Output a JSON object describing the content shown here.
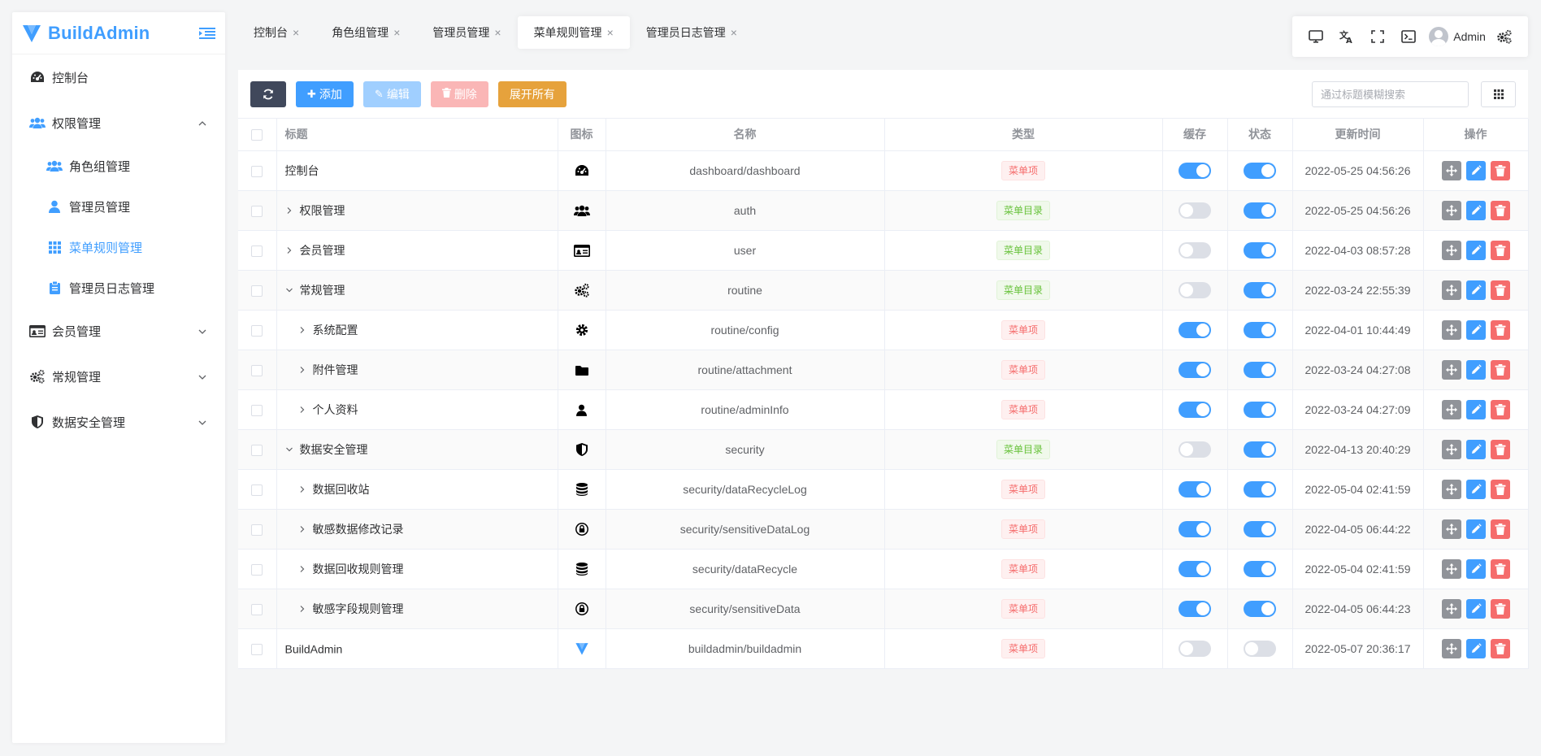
{
  "app": {
    "title": "BuildAdmin"
  },
  "sidebar": {
    "items": [
      {
        "label": "控制台"
      },
      {
        "label": "权限管理"
      },
      {
        "label": "角色组管理"
      },
      {
        "label": "管理员管理"
      },
      {
        "label": "菜单规则管理"
      },
      {
        "label": "管理员日志管理"
      },
      {
        "label": "会员管理"
      },
      {
        "label": "常规管理"
      },
      {
        "label": "数据安全管理"
      }
    ]
  },
  "tabs": [
    {
      "label": "控制台"
    },
    {
      "label": "角色组管理"
    },
    {
      "label": "管理员管理"
    },
    {
      "label": "菜单规则管理"
    },
    {
      "label": "管理员日志管理"
    }
  ],
  "navbar": {
    "user": "Admin"
  },
  "toolbar": {
    "add": "添加",
    "edit": "编辑",
    "delete": "删除",
    "expand_all": "展开所有",
    "search_placeholder": "通过标题模糊搜索"
  },
  "table": {
    "headers": {
      "title": "标题",
      "icon": "图标",
      "name": "名称",
      "type": "类型",
      "cache": "缓存",
      "status": "状态",
      "update_time": "更新时间",
      "operate": "操作"
    },
    "rows": [
      {
        "title": "控制台",
        "icon": "gauge-icon",
        "name": "dashboard/dashboard",
        "type": "菜单项",
        "cache": true,
        "status": true,
        "update_time": "2022-05-25 04:56:26"
      },
      {
        "title": "权限管理",
        "icon": "users-icon",
        "name": "auth",
        "type": "菜单目录",
        "cache": false,
        "status": true,
        "update_time": "2022-05-25 04:56:26"
      },
      {
        "title": "会员管理",
        "icon": "id-card-icon",
        "name": "user",
        "type": "菜单目录",
        "cache": false,
        "status": true,
        "update_time": "2022-04-03 08:57:28"
      },
      {
        "title": "常规管理",
        "icon": "gears-icon",
        "name": "routine",
        "type": "菜单目录",
        "cache": false,
        "status": true,
        "update_time": "2022-03-24 22:55:39"
      },
      {
        "title": "系统配置",
        "icon": "gear-icon",
        "name": "routine/config",
        "type": "菜单项",
        "cache": true,
        "status": true,
        "update_time": "2022-04-01 10:44:49"
      },
      {
        "title": "附件管理",
        "icon": "folder-icon",
        "name": "routine/attachment",
        "type": "菜单项",
        "cache": true,
        "status": true,
        "update_time": "2022-03-24 04:27:08"
      },
      {
        "title": "个人资料",
        "icon": "user-icon",
        "name": "routine/adminInfo",
        "type": "菜单项",
        "cache": true,
        "status": true,
        "update_time": "2022-03-24 04:27:09"
      },
      {
        "title": "数据安全管理",
        "icon": "shield-icon",
        "name": "security",
        "type": "菜单目录",
        "cache": false,
        "status": true,
        "update_time": "2022-04-13 20:40:29"
      },
      {
        "title": "数据回收站",
        "icon": "database-icon",
        "name": "security/dataRecycleLog",
        "type": "菜单项",
        "cache": true,
        "status": true,
        "update_time": "2022-05-04 02:41:59"
      },
      {
        "title": "敏感数据修改记录",
        "icon": "lock-icon",
        "name": "security/sensitiveDataLog",
        "type": "菜单项",
        "cache": true,
        "status": true,
        "update_time": "2022-04-05 06:44:22"
      },
      {
        "title": "数据回收规则管理",
        "icon": "database-icon",
        "name": "security/dataRecycle",
        "type": "菜单项",
        "cache": true,
        "status": true,
        "update_time": "2022-05-04 02:41:59"
      },
      {
        "title": "敏感字段规则管理",
        "icon": "lock-icon",
        "name": "security/sensitiveData",
        "type": "菜单项",
        "cache": true,
        "status": true,
        "update_time": "2022-04-05 06:44:23"
      },
      {
        "title": "BuildAdmin",
        "icon": "logo-icon",
        "name": "buildadmin/buildadmin",
        "type": "菜单项",
        "cache": false,
        "status": false,
        "update_time": "2022-05-07 20:36:17"
      }
    ]
  },
  "colors": {
    "primary": "#409eff",
    "danger": "#f56c6c",
    "success": "#67c23a",
    "warning": "#e6a23c",
    "dark": "#40485b"
  }
}
